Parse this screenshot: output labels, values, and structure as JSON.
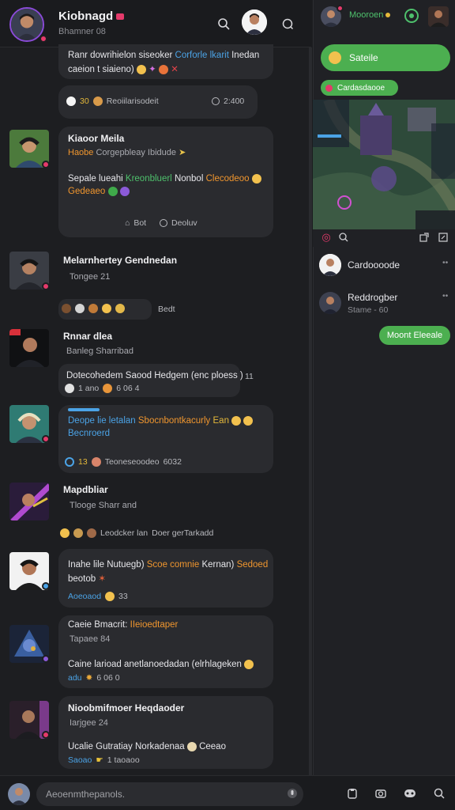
{
  "header": {
    "title": "Kiobnagd",
    "subtitle": "Bhamner 08",
    "right_label": "Mooroen",
    "live_color": "#e53a6b"
  },
  "feed": {
    "top_card": {
      "body_a": "Ranr dowrihielon siseoker",
      "body_b": "Corforle lkarit",
      "body_c": "Inedan",
      "body_d": "caeion t siaieno)",
      "meta_count": "30",
      "meta_text": "Reoiilarisodeit",
      "meta_time": "2:400"
    },
    "posts": [
      {
        "name": "Kiaoor Meila",
        "sub_a": "Haobe",
        "sub_b": "Corgepbleay Ibidude",
        "body_a": "Sepale lueahi",
        "body_b": "Kreonbluerl",
        "body_c": "Nonbol",
        "body_d": "Clecodeoo",
        "body_line2": "Gedeaeo",
        "action_1": "Bot",
        "action_2": "Deoluv"
      },
      {
        "name": "Melarnhertey Gendnedan",
        "sub": "Tongee 21",
        "meta": "Bedt"
      },
      {
        "name": "Rnnar dlea",
        "sub": "Banleg Sharribad",
        "body": "Dotecohedem Saood Hedgem (enc ploess )",
        "side_count": "11",
        "meta_a": "1 ano",
        "meta_b": "6 06 4"
      },
      {
        "name_a": "Deope lie letalan",
        "name_b": "Sbocnbontkacurly",
        "name_c": "Ean",
        "body": "Becnroerd",
        "meta_count": "13",
        "meta_text": "Teoneseoodeo",
        "meta_time": "6032"
      },
      {
        "name": "Mapdbliar",
        "sub": "Tlooge Sharr and",
        "meta_text": "Leodcker lan",
        "meta_b": "Doer gerTarkadd"
      },
      {
        "body_a": "Inahe lile Nutuegb)",
        "body_b": "Scoe comnie",
        "body_c": "Kernan)",
        "body_d": "Sedoed",
        "body_line2": "beotob",
        "meta_a": "Aoeoaod",
        "meta_b": "33"
      },
      {
        "name_a": "Caeie Bmacrit:",
        "name_b": "IIeioedtaper",
        "sub": "Tapaee 84",
        "body": "Caine larioad anetlanoedadan (elrhlageken",
        "meta_a": "adu",
        "meta_b": "6 06 0"
      },
      {
        "name": "Nioobmifmoer Heqdaoder",
        "sub": "Iarjgee 24",
        "body": "Ucalie Gutratiay Norkadenaa",
        "body_tail": "Ceeao",
        "meta_a": "Saoao",
        "meta_b": "1 taoaoo"
      }
    ]
  },
  "right_panel": {
    "pill_main": "Sateile",
    "pill_small": "Cardasdaooe",
    "users": [
      {
        "name": "Cardoooode",
        "sub": ""
      },
      {
        "name": "Reddrogber",
        "sub": "Stame - 60"
      }
    ],
    "reply_button": "Moont Eleeale"
  },
  "composer": {
    "placeholder": "Aeoenmthepanols."
  }
}
